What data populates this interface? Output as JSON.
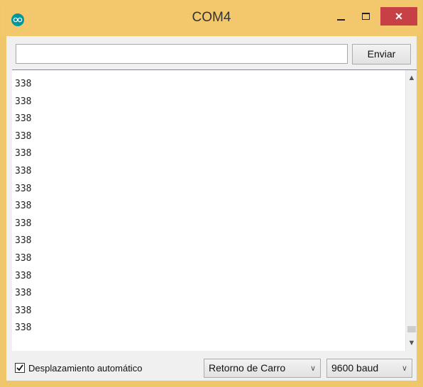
{
  "window": {
    "title": "COM4",
    "close_glyph": "×"
  },
  "send": {
    "input_value": "",
    "button_label": "Enviar"
  },
  "output": {
    "lines": [
      "338",
      "338",
      "338",
      "338",
      "338",
      "338",
      "338",
      "338",
      "338",
      "338",
      "338",
      "338",
      "338",
      "338",
      "338"
    ]
  },
  "footer": {
    "autoscroll_label": "Desplazamiento automático",
    "autoscroll_checked": true,
    "line_ending": "Retorno de Carro",
    "baud_rate": "9600 baud"
  },
  "colors": {
    "titlebar": "#f3c86c",
    "close_button": "#c74046",
    "app_icon": "#00979c"
  },
  "icons": {
    "app": "arduino-infinity-icon",
    "minimize": "minimize-icon",
    "maximize": "maximize-icon",
    "close": "close-icon",
    "scroll_up": "chevron-up-icon",
    "scroll_down": "chevron-down-icon",
    "dropdown": "chevron-down-icon"
  }
}
